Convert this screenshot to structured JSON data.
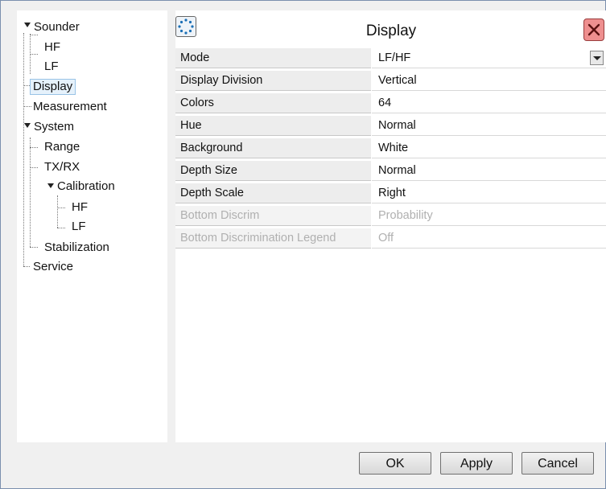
{
  "tree": {
    "items": [
      {
        "label": "Sounder"
      },
      {
        "label": "HF"
      },
      {
        "label": "LF"
      },
      {
        "label": "Display"
      },
      {
        "label": "Measurement"
      },
      {
        "label": "System"
      },
      {
        "label": "Range"
      },
      {
        "label": "TX/RX"
      },
      {
        "label": "Calibration"
      },
      {
        "label": "HF"
      },
      {
        "label": "LF"
      },
      {
        "label": "Stabilization"
      },
      {
        "label": "Service"
      }
    ],
    "selected": "Display"
  },
  "panel": {
    "title": "Display",
    "rows": [
      {
        "label": "Mode",
        "value": "LF/HF"
      },
      {
        "label": "Display Division",
        "value": "Vertical"
      },
      {
        "label": "Colors",
        "value": "64"
      },
      {
        "label": "Hue",
        "value": "Normal"
      },
      {
        "label": "Background",
        "value": "White"
      },
      {
        "label": "Depth Size",
        "value": "Normal"
      },
      {
        "label": "Depth Scale",
        "value": "Right"
      },
      {
        "label": "Bottom Discrim",
        "value": "Probability"
      },
      {
        "label": "Bottom Discrimination Legend",
        "value": "Off"
      }
    ]
  },
  "buttons": {
    "ok": "OK",
    "apply": "Apply",
    "cancel": "Cancel"
  },
  "colors": {
    "close_button": "#ee8f8f",
    "selection": "#e5f1fb",
    "window_border": "#4d6b9a"
  }
}
